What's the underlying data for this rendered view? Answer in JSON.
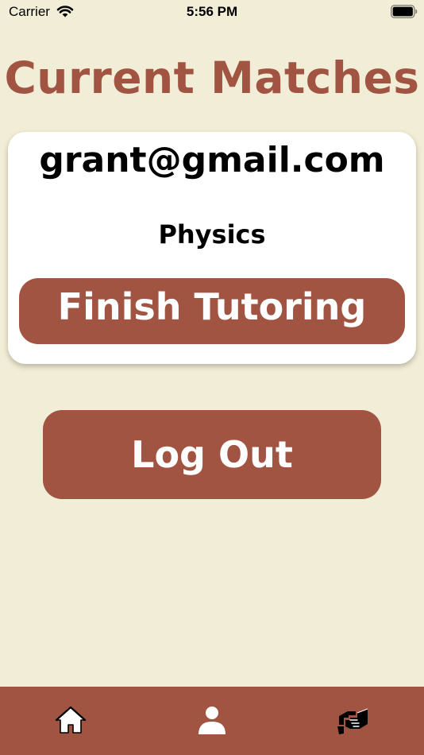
{
  "status_bar": {
    "carrier": "Carrier",
    "time": "5:56 PM",
    "icons": [
      "wifi-icon",
      "battery-icon"
    ]
  },
  "page": {
    "title": "Current Matches"
  },
  "match": {
    "email": "grant@gmail.com",
    "subject": "Physics",
    "finish_label": "Finish Tutoring"
  },
  "actions": {
    "logout_label": "Log Out"
  },
  "tab_bar": {
    "items": [
      {
        "icon": "home-icon"
      },
      {
        "icon": "person-icon"
      },
      {
        "icon": "handshake-icon"
      }
    ]
  },
  "colors": {
    "background": "#f1edd6",
    "accent": "#a25443",
    "card": "#ffffff"
  }
}
